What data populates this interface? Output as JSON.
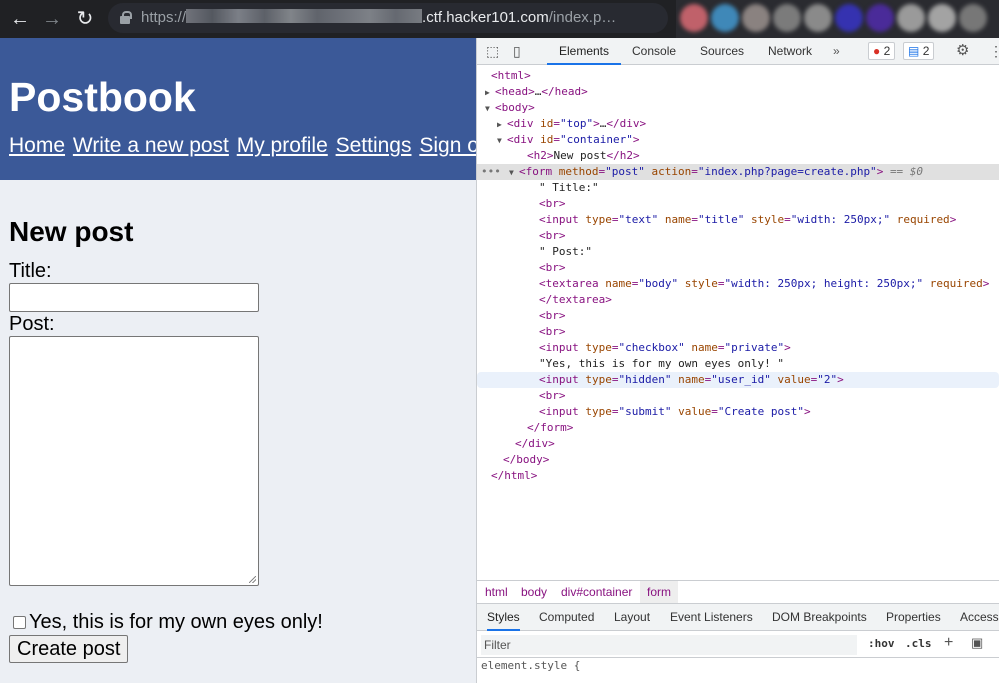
{
  "browser": {
    "url_scheme": "https://",
    "url_domain": ".ctf.hacker101.com",
    "url_path": "/index.p…",
    "ext_colors": [
      "#c0616a",
      "#3f88b8",
      "#8a8280",
      "#7b7b7b",
      "#8a8a8a",
      "#3532b0",
      "#4a2b99",
      "#9a9a9a",
      "#a3a3a3",
      "#777777"
    ]
  },
  "page": {
    "site_title": "Postbook",
    "nav": [
      "Home",
      "Write a new post",
      "My profile",
      "Settings",
      "Sign out"
    ],
    "heading": "New post",
    "title_label": "Title:",
    "title_value": "",
    "post_label": "Post:",
    "post_value": "",
    "private_label": "Yes, this is for my own eyes only!",
    "submit_label": "Create post",
    "colors": {
      "header_bg": "#3b5998",
      "page_bg": "#eceff4"
    }
  },
  "devtools": {
    "tabs": [
      "Elements",
      "Console",
      "Sources",
      "Network"
    ],
    "more": "»",
    "error_count": "2",
    "message_count": "2",
    "dom_lines": [
      "<html>",
      "<head>…</head>",
      "<body>",
      "<div id=\"top\">…</div>",
      "<div id=\"container\">",
      "<h2>New post</h2>",
      "<form method=\"post\" action=\"index.php?page=create.php\">",
      "\" Title:\"",
      "<br>",
      "<input type=\"text\" name=\"title\" style=\"width: 250px;\" required>",
      "<br>",
      "\" Post:\"",
      "<br>",
      "<textarea name=\"body\" style=\"width: 250px; height: 250px;\" required>",
      "</textarea>",
      "<br>",
      "<br>",
      "<input type=\"checkbox\" name=\"private\">",
      "\"Yes, this is for my own eyes only! \"",
      "<input type=\"hidden\" name=\"user_id\" value=\"2\">",
      "<br>",
      "<input type=\"submit\" value=\"Create post\">",
      "</form>",
      "</div>",
      "</body>",
      "</html>"
    ],
    "selected_marker": "== $0",
    "breadcrumbs": [
      "html",
      "body",
      "div#container",
      "form"
    ],
    "style_tabs": [
      "Styles",
      "Computed",
      "Layout",
      "Event Listeners",
      "DOM Breakpoints",
      "Properties",
      "Access"
    ],
    "filter_placeholder": "Filter",
    "hov": ":hov",
    "cls": ".cls",
    "element_style": "element.style {"
  }
}
